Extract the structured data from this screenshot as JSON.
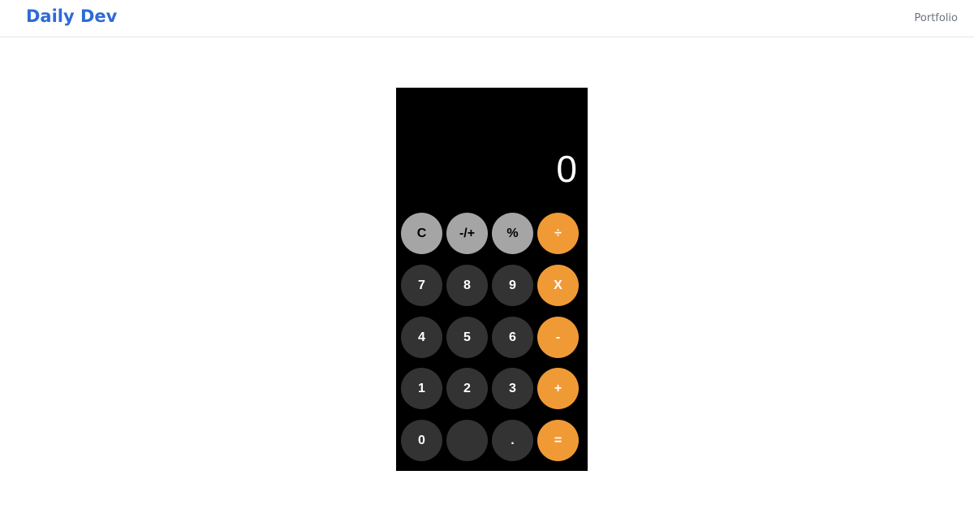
{
  "navbar": {
    "brand": "Daily Dev",
    "links": [
      "Portfolio"
    ]
  },
  "colors": {
    "brand": "#2e6ad8",
    "function_key": "#a5a5a5",
    "number_key": "#333333",
    "operator_key": "#f09a36",
    "calculator_bg": "#000000"
  },
  "calculator": {
    "display": "0",
    "rows": [
      [
        {
          "label": "C",
          "type": "fn",
          "name": "clear"
        },
        {
          "label": "-/+",
          "type": "fn",
          "name": "negate"
        },
        {
          "label": "%",
          "type": "fn",
          "name": "percent"
        },
        {
          "label": "÷",
          "type": "op",
          "name": "divide"
        }
      ],
      [
        {
          "label": "7",
          "type": "num",
          "name": "7"
        },
        {
          "label": "8",
          "type": "num",
          "name": "8"
        },
        {
          "label": "9",
          "type": "num",
          "name": "9"
        },
        {
          "label": "X",
          "type": "op",
          "name": "multiply"
        }
      ],
      [
        {
          "label": "4",
          "type": "num",
          "name": "4"
        },
        {
          "label": "5",
          "type": "num",
          "name": "5"
        },
        {
          "label": "6",
          "type": "num",
          "name": "6"
        },
        {
          "label": "-",
          "type": "op",
          "name": "subtract"
        }
      ],
      [
        {
          "label": "1",
          "type": "num",
          "name": "1"
        },
        {
          "label": "2",
          "type": "num",
          "name": "2"
        },
        {
          "label": "3",
          "type": "num",
          "name": "3"
        },
        {
          "label": "+",
          "type": "op",
          "name": "add"
        }
      ],
      [
        {
          "label": "0",
          "type": "num",
          "name": "0"
        },
        {
          "label": "",
          "type": "num",
          "name": "blank"
        },
        {
          "label": ".",
          "type": "num",
          "name": "decimal"
        },
        {
          "label": "=",
          "type": "op",
          "name": "equals"
        }
      ]
    ]
  }
}
